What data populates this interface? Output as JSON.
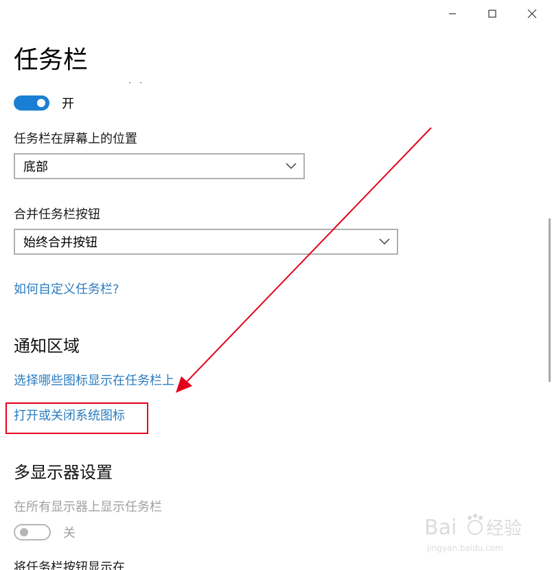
{
  "window": {
    "title": "任务栏",
    "controls": [
      "minimize",
      "maximize",
      "close"
    ]
  },
  "taskbar_toggle": {
    "state_label": "开",
    "on": true
  },
  "position_setting": {
    "label": "任务栏在屏幕上的位置",
    "value": "底部"
  },
  "combine_setting": {
    "label": "合并任务栏按钮",
    "value": "始终合并按钮"
  },
  "links": {
    "customize": "如何自定义任务栏?"
  },
  "notification_area": {
    "heading": "通知区域",
    "link_select_icons": "选择哪些图标显示在任务栏上",
    "link_system_icons": "打开或关闭系统图标"
  },
  "multi_display": {
    "heading": "多显示器设置",
    "show_all_label": "在所有显示器上显示任务栏",
    "toggle_state_label": "关",
    "toggle_on": false,
    "buttons_label": "将任务栏按钮显示在"
  },
  "annotation": {
    "arrow_color": "#e3001b",
    "box_color": "#e3001b"
  },
  "icons": {
    "minimize": "minimize-icon",
    "maximize": "maximize-icon",
    "close": "close-icon",
    "dropdown": "chevron-down-icon",
    "watermark": "baidu-jingyan-logo"
  },
  "colors": {
    "accent": "#1a7fd4",
    "link": "#2a7cc0"
  }
}
